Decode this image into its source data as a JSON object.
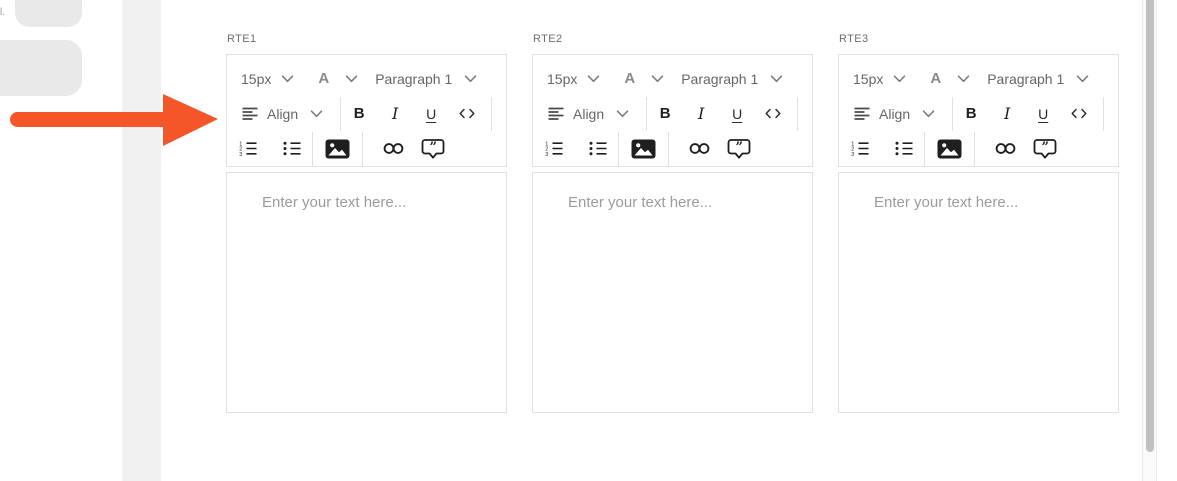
{
  "left_panel": {
    "clipped_text_fragment": "l."
  },
  "annotation_arrow": {
    "direction": "right",
    "color": "#f4562a"
  },
  "editors": [
    {
      "id": "rte1",
      "label": "RTE1",
      "placeholder": "Enter your text here..."
    },
    {
      "id": "rte2",
      "label": "RTE2",
      "placeholder": "Enter your text here..."
    },
    {
      "id": "rte3",
      "label": "RTE3",
      "placeholder": "Enter your text here..."
    }
  ],
  "toolbar": {
    "font_size_value": "15px",
    "font_color_label": "A",
    "paragraph_format_value": "Paragraph 1",
    "align_label": "Align",
    "bold_label": "B",
    "italic_label": "I",
    "underline_label": "U",
    "icons": {
      "dropdown": "chevron-down",
      "alignments": "align-left-lines",
      "code_view": "angle-brackets",
      "ordered_list": "numbered-list",
      "unordered_list": "bulleted-list",
      "insert_image": "image-photo",
      "create_link": "chain-links",
      "blockquote": "quote-speech-bubble"
    }
  },
  "colors": {
    "arrow_accent": "#f4562a",
    "box_border": "#e0e0e0",
    "toolbar_text": "#666666",
    "icon_black": "#1f1f1f",
    "placeholder_text": "#9b9b9b",
    "label_text": "#6e6e6e",
    "panel_gray": "#e9e9e9",
    "strip_gray": "#f0f0f0",
    "scrollbar_thumb": "#c1c1c1"
  },
  "scrollbar": {
    "orientation": "vertical",
    "thumb_extent": "top-to-94%"
  }
}
